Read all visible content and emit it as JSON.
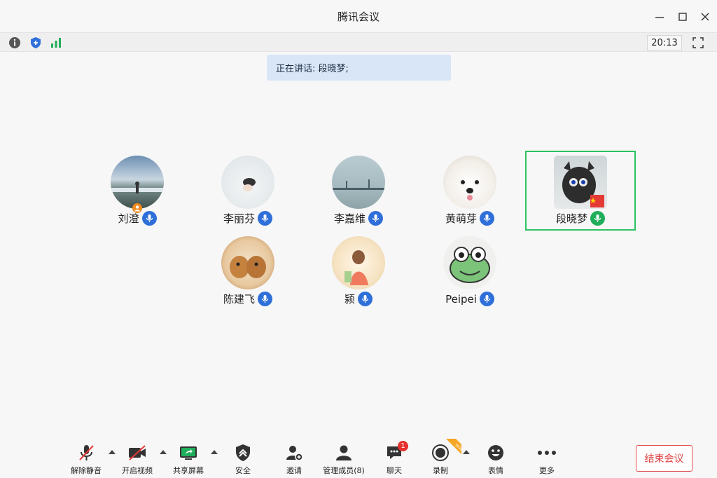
{
  "window": {
    "title": "腾讯会议"
  },
  "status": {
    "time": "20:13"
  },
  "banner": {
    "label": "正在讲话: 段晓梦;"
  },
  "participants": [
    {
      "name": "刘澄",
      "host": true
    },
    {
      "name": "李丽芬"
    },
    {
      "name": "李嘉维"
    },
    {
      "name": "黄萌芽"
    },
    {
      "name": "段晓梦",
      "speaking": true
    },
    {
      "name": "陈建飞"
    },
    {
      "name": "颍"
    },
    {
      "name": "Peipei"
    }
  ],
  "toolbar": {
    "unmute": "解除静音",
    "video": "开启视频",
    "share": "共享屏幕",
    "security": "安全",
    "invite": "邀请",
    "members": "管理成员(8)",
    "chat": "聊天",
    "chat_badge": "1",
    "record": "录制",
    "record_tag": "NEW",
    "emoji": "表情",
    "more": "更多",
    "end": "结束会议"
  },
  "colors": {
    "accent": "#2f6fd9",
    "speaking": "#2ec262",
    "danger": "#e04343"
  }
}
